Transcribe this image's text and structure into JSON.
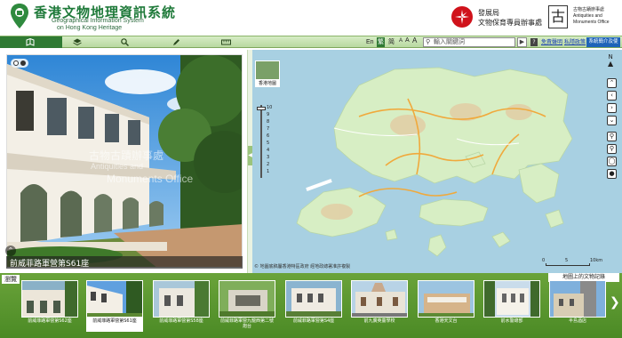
{
  "header": {
    "title_zh": "香港文物地理資訊系統",
    "title_en_line1": "Geographical Information System",
    "title_en_line2": "on Hong Kong Heritage",
    "devb_line1": "發展局",
    "devb_line2": "文物保育專員辦事處",
    "amo_glyph": "古",
    "amo_zh": "古物古蹟辦事處",
    "amo_en1": "Antiquities and",
    "amo_en2": "Monuments Office"
  },
  "toolbar": {
    "tabs": [
      "map-layers-icon",
      "layers-icon",
      "search-icon",
      "pen-icon",
      "ruler-icon"
    ],
    "lang_en": "En",
    "lang_tc": "繁",
    "lang_sc": "简",
    "font_small": "A",
    "font_medium": "A",
    "font_large": "A",
    "search_placeholder": "輸入關鍵詞",
    "help": "?",
    "disclaimer": "免責聲明",
    "privacy": "私隱政策",
    "intro": "系統簡介及使用指引"
  },
  "photo": {
    "caption": "前威菲路軍營第S61座",
    "watermark_zh": "古物古蹟辦事處",
    "watermark_en1": "Antiquities and",
    "watermark_en2": "Monuments Office"
  },
  "map": {
    "thumb_label": "香港地圖",
    "zoom_ticks": [
      "10",
      "9",
      "8",
      "7",
      "6",
      "5",
      "4",
      "3",
      "2",
      "1"
    ],
    "north": "N",
    "copyright": "© 地圖底稿屬香港特區政府 經地政總署准許複製",
    "scale_left": "0",
    "scale_mid": "5",
    "scale_right": "10km"
  },
  "bottom": {
    "browse": "瀏覽",
    "world_heritage": "地圖上的文物記錄",
    "thumbs": [
      {
        "label": "前威菲路軍營第S62座"
      },
      {
        "label": "前威菲路軍營第S61座"
      },
      {
        "label": "前威菲路軍營第S58座"
      },
      {
        "label": "前威菲路軍營九龍西第二號炮台"
      },
      {
        "label": "前威菲路軍營第S4座"
      },
      {
        "label": "前九廣英童學校"
      },
      {
        "label": "香港天文台"
      },
      {
        "label": "前水警總部"
      },
      {
        "label": "半島酒店"
      }
    ]
  }
}
